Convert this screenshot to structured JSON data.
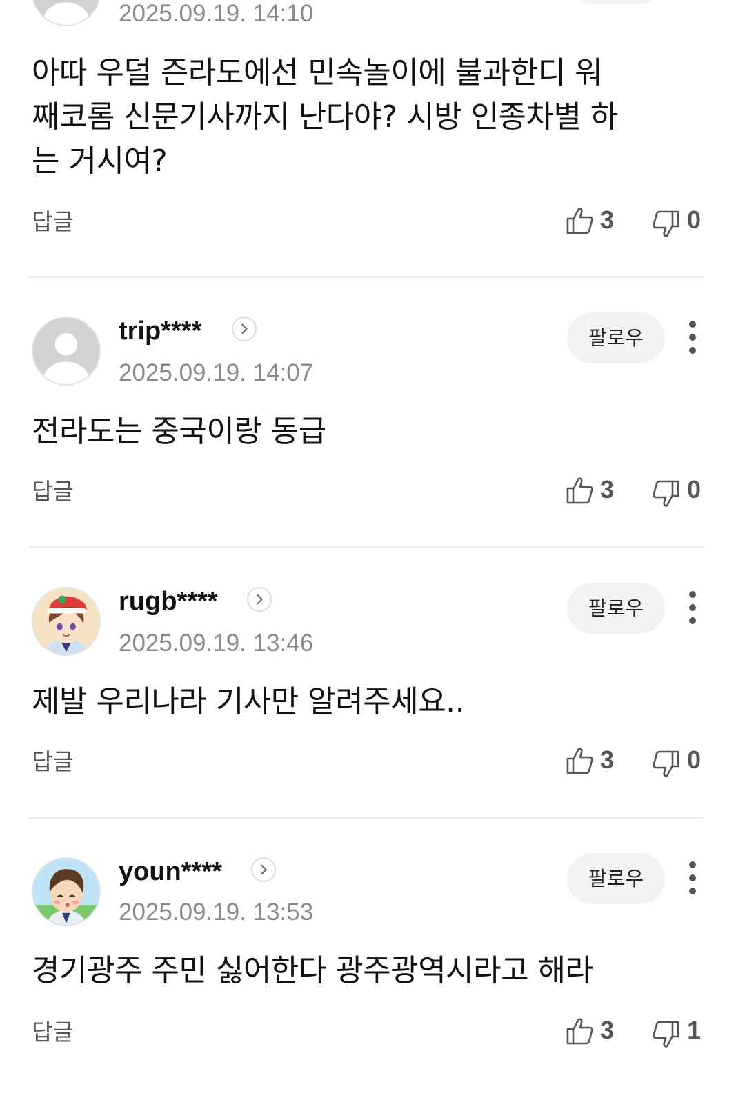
{
  "comments": [
    {
      "username": "",
      "timestamp": "2025.09.19. 14:10",
      "text_lines": [
        "아따 우덜 즌라도에선 민속놀이에 불과한디 워",
        "째코롬 신문기사까지 난다야? 시방 인종차별 하",
        "는 거시여?"
      ],
      "reply_label": "답글",
      "likes": "3",
      "dislikes": "0"
    },
    {
      "username": "trip****",
      "timestamp": "2025.09.19. 14:07",
      "follow_label": "팔로우",
      "text_lines": [
        "전라도는 중국이랑 동급"
      ],
      "reply_label": "답글",
      "likes": "3",
      "dislikes": "0",
      "avatar": "default-profile-icon"
    },
    {
      "username": "rugb****",
      "timestamp": "2025.09.19. 13:46",
      "follow_label": "팔로우",
      "text_lines": [
        "제발 우리나라 기사만 알려주세요.."
      ],
      "reply_label": "답글",
      "likes": "3",
      "dislikes": "0",
      "avatar": "cartoon-character-santa-hat"
    },
    {
      "username": "youn****",
      "timestamp": "2025.09.19. 13:53",
      "follow_label": "팔로우",
      "text_lines": [
        "경기광주 주민 싫어한다 광주광역시라고 해라"
      ],
      "reply_label": "답글",
      "likes": "3",
      "dislikes": "1",
      "avatar": "cartoon-character-wink"
    }
  ],
  "colors": {
    "text": "#111111",
    "muted": "#8a8a8a",
    "icon": "#555555",
    "follow_bg": "#f2f2f2",
    "divider": "#ececec"
  }
}
